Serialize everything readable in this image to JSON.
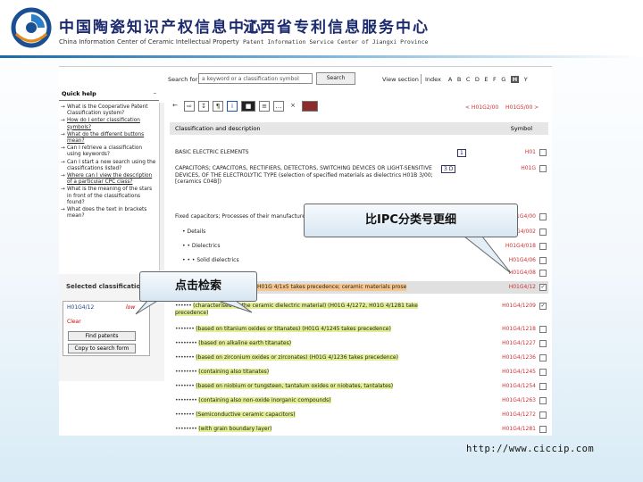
{
  "header": {
    "org_cn_1": "中国陶瓷知识产权信息中心",
    "org_en_1": "China Information Center of Ceramic Intellectual Property",
    "org_cn_2": "江西省专利信息服务中心",
    "org_en_2": "Patent Information Service Center of Jiangxi Province",
    "logo_icon": "ccip-logo-icon"
  },
  "search": {
    "label": "Search for",
    "placeholder": "a keyword or a classification symbol",
    "button": "Search",
    "view_section": "View section",
    "index": "Index",
    "letters": [
      "A",
      "B",
      "C",
      "D",
      "E",
      "F",
      "G",
      "H",
      "Y"
    ],
    "selected_letter": "H"
  },
  "quick_help": {
    "title": "Quick help",
    "collapse": "–",
    "items": [
      {
        "text": "What is the Cooperative Patent Classification system?",
        "link": false
      },
      {
        "text": "How do I enter classification symbols?",
        "link": true
      },
      {
        "text": "What do the different buttons mean?",
        "link": true
      },
      {
        "text": "Can I retrieve a classification using keywords?",
        "link": false
      },
      {
        "text": "Can I start a new search using the classifications listed?",
        "link": false
      },
      {
        "text": "Where can I view the description of a particular CPC class?",
        "link": true
      },
      {
        "text": "What is the meaning of the stars in front of the classifications found?",
        "link": false
      },
      {
        "text": "What does the text in brackets mean?",
        "link": false
      }
    ]
  },
  "selected": {
    "title": "Selected classification",
    "code": "H01G4/12",
    "flag": "low",
    "clear": "Clear",
    "find_button": "Find patents",
    "copy_button": "Copy to search form"
  },
  "toolbar": {
    "icons": [
      "back-icon",
      "forward-icon",
      "collapse-icon",
      "notes-icon",
      "info-icon",
      "ipc-icon",
      "list-icon",
      "more-icon",
      "close-icon",
      "red-tag-icon"
    ],
    "code_left": "< H01G2/00",
    "code_right": "H01G5/00 >"
  },
  "table": {
    "col_classification": "Classification and description",
    "col_symbol": "Symbol",
    "rows": [
      {
        "text": "BASIC ELECTRIC ELEMENTS",
        "symbol": "H01",
        "badge": "1"
      },
      {
        "text": "CAPACITORS; CAPACITORS, RECTIFIERS, DETECTORS, SWITCHING DEVICES OR LIGHT-SENSITIVE DEVICES, OF THE ELECTROLYTIC TYPE (selection of specified materials as dielectrics H01B 3/00; [ceramics C04B])",
        "symbol": "H01G",
        "badge": "3 D"
      },
      {
        "text": "Fixed capacitors; Processes of their manufacture",
        "symbol": "H01G4/00"
      },
      {
        "text": "• Details",
        "symbol": "H01G4/002"
      },
      {
        "text": "• • Dielectrics",
        "symbol": "H01G4/018"
      },
      {
        "text": "• • • Solid dielectrics",
        "symbol": "H01G4/06"
      },
      {
        "text": "",
        "symbol": "H01G4/08"
      },
      {
        "text": "H01G 4/1x5 takes precedence; ceramic materials prose",
        "symbol": "H01G4/12"
      },
      {
        "text": "(characterised by the ceramic dielectric material) (H01G 4/1272, H01G 4/1281 take precedence)",
        "symbol": "H01G4/1209"
      },
      {
        "text": "(based on titanium oxides or titanates) (H01G 4/1245 takes precedence)",
        "symbol": "H01G4/1218"
      },
      {
        "text": "(based on alkaline earth titanates)",
        "symbol": "H01G4/1227"
      },
      {
        "text": "(based on zirconium oxides or zirconates) (H01G 4/1236 takes precedence)",
        "symbol": "H01G4/1236"
      },
      {
        "text": "(containing also titanates)",
        "symbol": "H01G4/1245"
      },
      {
        "text": "(based on niobium or tungsteen, tantalum oxides or niobates, tantalates)",
        "symbol": "H01G4/1254"
      },
      {
        "text": "(containing also non-oxide inorganic compounds)",
        "symbol": "H01G4/1263"
      },
      {
        "text": "(Semiconductive ceramic capacitors)",
        "symbol": "H01G4/1272"
      },
      {
        "text": "(with grain boundary layer)",
        "symbol": "H01G4/1281"
      }
    ]
  },
  "callouts": {
    "big": "比IPC分类号更细",
    "small": "点击检索"
  },
  "footer_url": "http://www.ciccip.com",
  "colors": {
    "banner_blue": "#1a6aa8",
    "highlight_yellow": "#e3ef92",
    "highlight_orange": "#f6c68e",
    "symbol_red": "#c33"
  }
}
